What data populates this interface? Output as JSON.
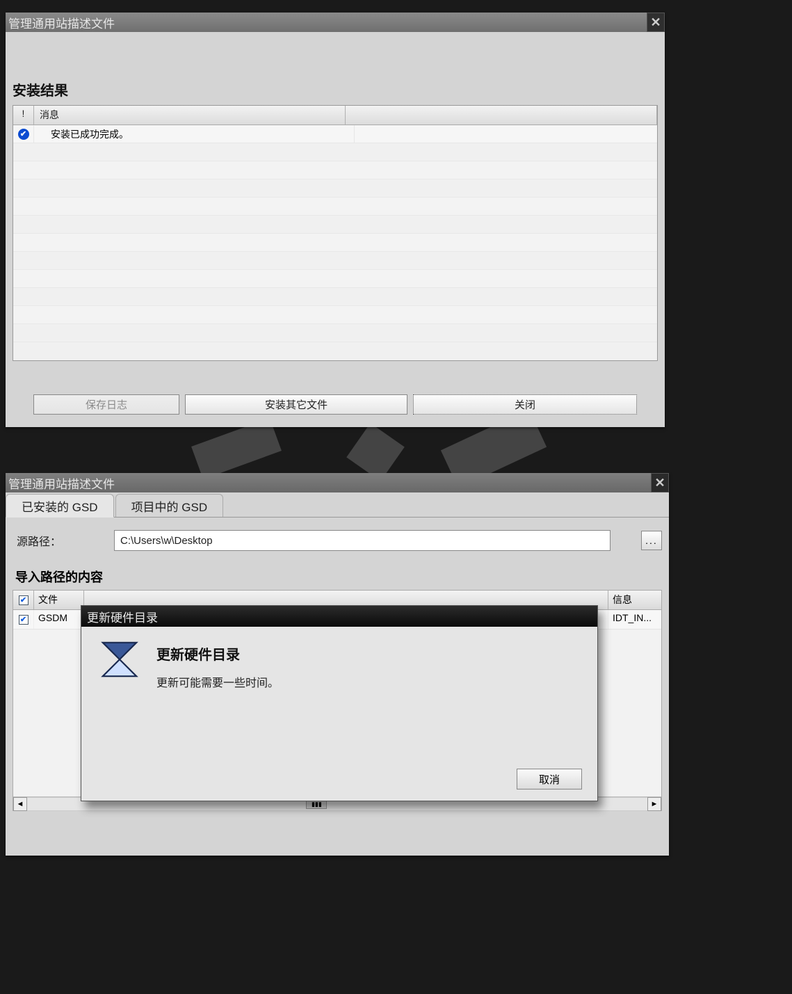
{
  "window1": {
    "title": "管理通用站描述文件",
    "section_title": "安装结果",
    "table": {
      "header_icon": "!",
      "header_message": "消息",
      "rows": [
        {
          "icon": "check",
          "message": "安装已成功完成。"
        }
      ]
    },
    "buttons": {
      "save_log": "保存日志",
      "install_other": "安装其它文件",
      "close": "关闭"
    }
  },
  "window2": {
    "title": "管理通用站描述文件",
    "tabs": [
      {
        "label": "已安装的 GSD",
        "active": true
      },
      {
        "label": "项目中的 GSD",
        "active": false
      }
    ],
    "source_path_label": "源路径：",
    "source_path_value": "C:\\Users\\w\\Desktop",
    "browse": "...",
    "content_label": "导入路径的内容",
    "table": {
      "header_check": "✔",
      "header_file": "文件",
      "header_info": "信息",
      "rows": [
        {
          "checked": true,
          "file": "GSDM",
          "info": "IDT_IN..."
        }
      ]
    },
    "scroll": {
      "left": "◄",
      "right": "►",
      "thumb": "▮▮▮"
    }
  },
  "modal": {
    "title": "更新硬件目录",
    "heading": "更新硬件目录",
    "subtext": "更新可能需要一些时间。",
    "cancel": "取消"
  }
}
